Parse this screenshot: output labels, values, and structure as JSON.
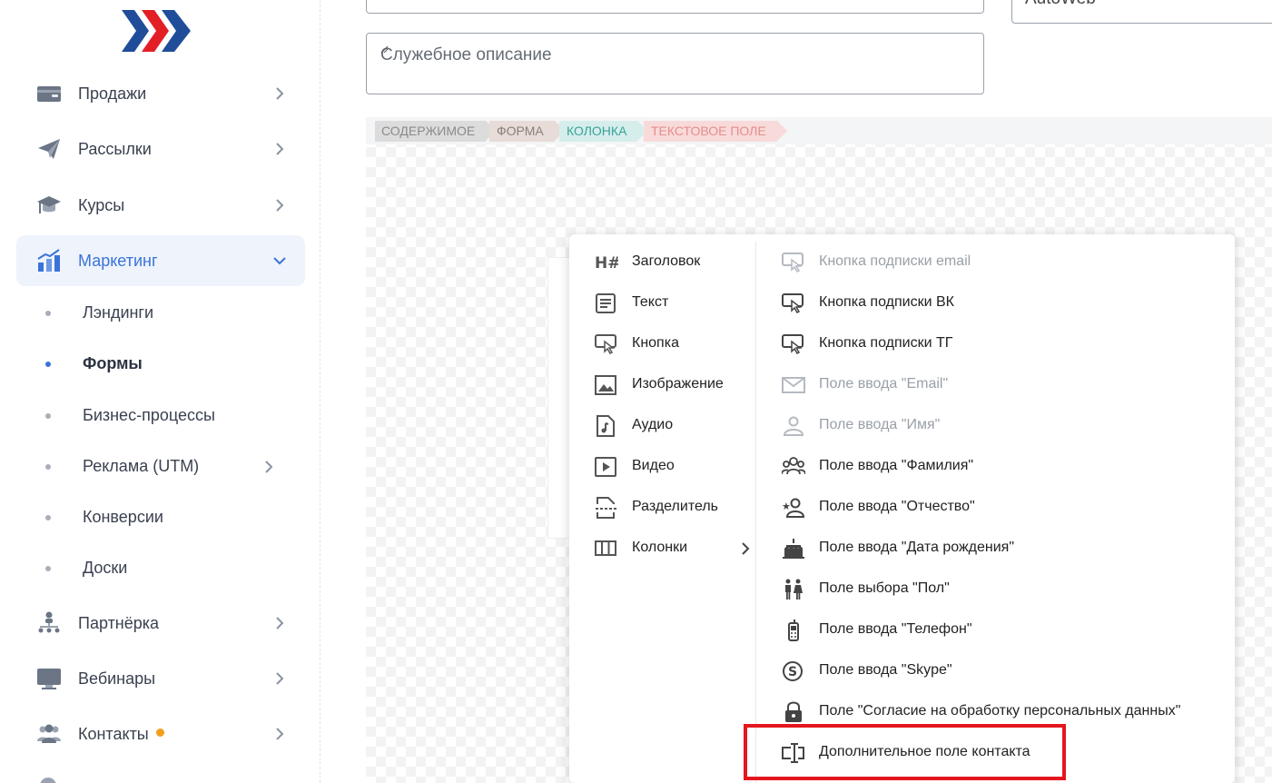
{
  "sidebar": {
    "items": [
      {
        "label": "Продажи",
        "icon": "wallet-icon"
      },
      {
        "label": "Рассылки",
        "icon": "paper-plane-icon"
      },
      {
        "label": "Курсы",
        "icon": "graduation-cap-icon"
      },
      {
        "label": "Маркетинг",
        "icon": "chart-bar-icon",
        "active": true
      },
      {
        "label": "Партнёрка",
        "icon": "hierarchy-icon"
      },
      {
        "label": "Вебинары",
        "icon": "monitor-icon"
      },
      {
        "label": "Контакты",
        "icon": "users-icon",
        "badge": true
      }
    ],
    "marketing_sub": [
      {
        "label": "Лэндинги"
      },
      {
        "label": "Формы",
        "active": true
      },
      {
        "label": "Бизнес-процессы"
      },
      {
        "label": "Реклама (UTM)",
        "has_submenu": true
      },
      {
        "label": "Конверсии"
      },
      {
        "label": "Доски"
      }
    ]
  },
  "form": {
    "top_right_value": "AutoWeb",
    "description_placeholder": "Служебное описание"
  },
  "breadcrumb": [
    "СОДЕРЖИМОЕ",
    "ФОРМА",
    "КОЛОНКА",
    "ТЕКСТОВОЕ ПОЛЕ"
  ],
  "dropdown": {
    "left": [
      {
        "label": "Заголовок",
        "icon": "heading-icon"
      },
      {
        "label": "Текст",
        "icon": "text-icon"
      },
      {
        "label": "Кнопка",
        "icon": "button-icon"
      },
      {
        "label": "Изображение",
        "icon": "image-icon"
      },
      {
        "label": "Аудио",
        "icon": "audio-file-icon"
      },
      {
        "label": "Видео",
        "icon": "video-icon"
      },
      {
        "label": "Разделитель",
        "icon": "divider-icon"
      },
      {
        "label": "Колонки",
        "icon": "columns-icon",
        "has_submenu": true
      }
    ],
    "right": [
      {
        "label": "Кнопка подписки email",
        "icon": "subscribe-button-icon",
        "disabled": true
      },
      {
        "label": "Кнопка подписки ВК",
        "icon": "subscribe-button-icon"
      },
      {
        "label": "Кнопка подписки ТГ",
        "icon": "subscribe-button-icon"
      },
      {
        "label": "Поле ввода \"Email\"",
        "icon": "envelope-icon",
        "disabled": true
      },
      {
        "label": "Поле ввода \"Имя\"",
        "icon": "user-icon",
        "disabled": true
      },
      {
        "label": "Поле ввода \"Фамилия\"",
        "icon": "family-icon"
      },
      {
        "label": "Поле ввода \"Отчество\"",
        "icon": "user-star-icon"
      },
      {
        "label": "Поле ввода \"Дата рождения\"",
        "icon": "birthday-cake-icon"
      },
      {
        "label": "Поле выбора \"Пол\"",
        "icon": "gender-icon"
      },
      {
        "label": "Поле ввода \"Телефон\"",
        "icon": "phone-icon"
      },
      {
        "label": "Поле ввода \"Skype\"",
        "icon": "skype-icon"
      },
      {
        "label": "Поле \"Согласие на обработку персональных данных\"",
        "icon": "lock-icon"
      },
      {
        "label": "Дополнительное поле контакта",
        "icon": "text-field-icon",
        "highlighted": true
      }
    ]
  },
  "colors": {
    "accent": "#3b73d8",
    "highlight_border": "#e5161e",
    "badge": "#f29e1e",
    "logo_blue": "#1f4d9a",
    "logo_red": "#e31f26"
  }
}
